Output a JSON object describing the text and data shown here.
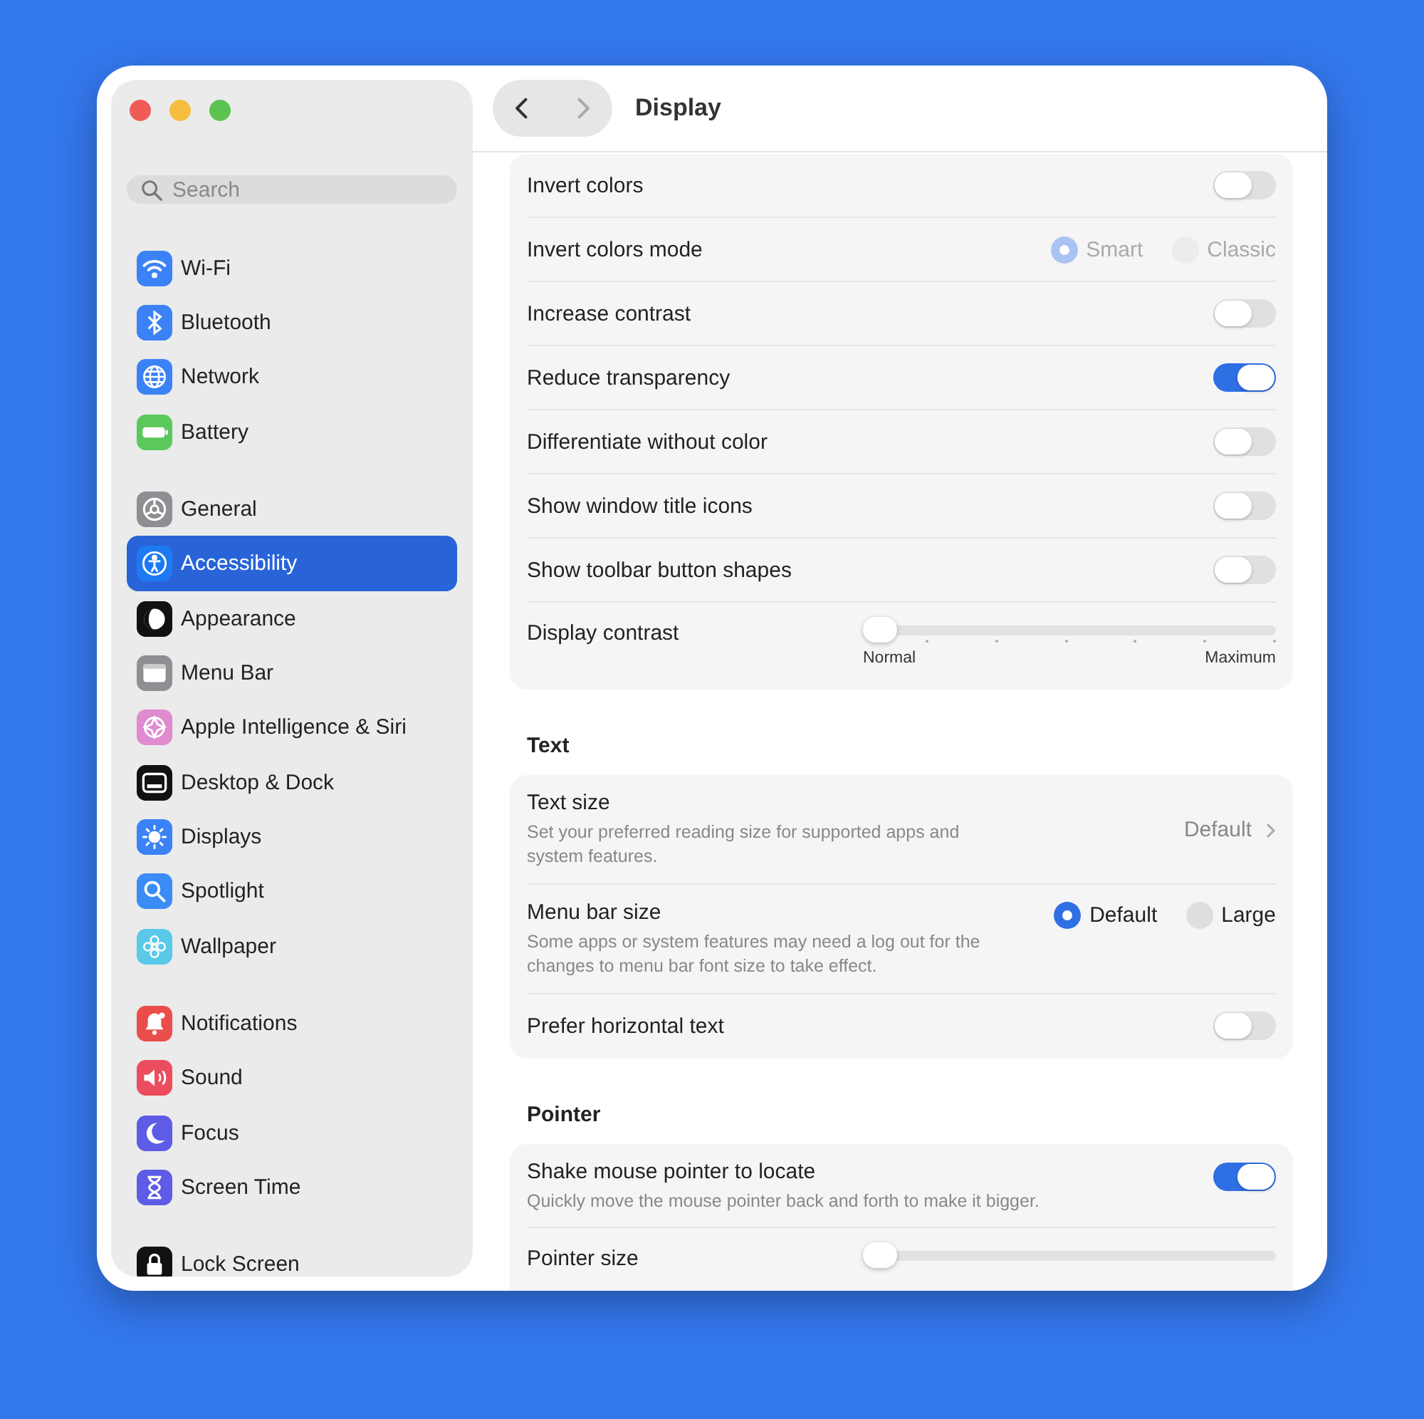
{
  "window": {
    "title": "Display"
  },
  "sidebar": {
    "search": {
      "placeholder": "Search"
    },
    "groups": [
      {
        "items": [
          {
            "label": "Wi-Fi",
            "color": "#3b82f6",
            "selected": false
          },
          {
            "label": "Bluetooth",
            "color": "#3b82f6",
            "selected": false
          },
          {
            "label": "Network",
            "color": "#3b82f6",
            "selected": false
          },
          {
            "label": "Battery",
            "color": "#5ac85a",
            "selected": false
          }
        ]
      },
      {
        "items": [
          {
            "label": "General",
            "color": "#8e8e93",
            "selected": false
          },
          {
            "label": "Accessibility",
            "color": "#1d7af2",
            "selected": true
          },
          {
            "label": "Appearance",
            "color": "#111111",
            "selected": false
          },
          {
            "label": "Menu Bar",
            "color": "#8e8e93",
            "selected": false
          },
          {
            "label": "Apple Intelligence & Siri",
            "color": "#e08ad0",
            "selected": false
          },
          {
            "label": "Desktop & Dock",
            "color": "#111111",
            "selected": false
          },
          {
            "label": "Displays",
            "color": "#3b82f6",
            "selected": false
          },
          {
            "label": "Spotlight",
            "color": "#3b8cf6",
            "selected": false
          },
          {
            "label": "Wallpaper",
            "color": "#5ac8e8",
            "selected": false
          }
        ]
      },
      {
        "items": [
          {
            "label": "Notifications",
            "color": "#eb4d4b",
            "selected": false
          },
          {
            "label": "Sound",
            "color": "#eb4d5e",
            "selected": false
          },
          {
            "label": "Focus",
            "color": "#5e5ce6",
            "selected": false
          },
          {
            "label": "Screen Time",
            "color": "#5e5ce6",
            "selected": false
          }
        ]
      },
      {
        "items": [
          {
            "label": "Lock Screen",
            "color": "#111111",
            "selected": false
          }
        ]
      }
    ]
  },
  "sections": [
    {
      "rows": [
        {
          "kind": "toggle",
          "label": "Invert colors",
          "on": false
        },
        {
          "kind": "radio",
          "label": "Invert colors mode",
          "disabled": true,
          "options": [
            {
              "label": "Smart",
              "selected": true
            },
            {
              "label": "Classic",
              "selected": false
            }
          ]
        },
        {
          "kind": "toggle",
          "label": "Increase contrast",
          "on": false
        },
        {
          "kind": "toggle",
          "label": "Reduce transparency",
          "on": true
        },
        {
          "kind": "toggle",
          "label": "Differentiate without color",
          "on": false
        },
        {
          "kind": "toggle",
          "label": "Show window title icons",
          "on": false
        },
        {
          "kind": "toggle",
          "label": "Show toolbar button shapes",
          "on": false
        },
        {
          "kind": "slider",
          "label": "Display contrast",
          "level": 0,
          "min_label": "Normal",
          "max_label": "Maximum"
        }
      ]
    },
    {
      "title": "Text",
      "rows": [
        {
          "kind": "value",
          "label": "Text size",
          "description": "Set your preferred reading size for supported apps and system features.",
          "value": "Default"
        },
        {
          "kind": "radio",
          "label": "Menu bar size",
          "description": "Some apps or system features may need a log out for the changes to menu bar font size to take effect.",
          "disabled": false,
          "options": [
            {
              "label": "Default",
              "selected": true
            },
            {
              "label": "Large",
              "selected": false
            }
          ]
        },
        {
          "kind": "toggle",
          "label": "Prefer horizontal text",
          "on": false
        }
      ]
    },
    {
      "title": "Pointer",
      "rows": [
        {
          "kind": "toggle",
          "label": "Shake mouse pointer to locate",
          "description": "Quickly move the mouse pointer back and forth to make it bigger.",
          "on": true
        },
        {
          "kind": "slider",
          "label": "Pointer size",
          "level": 0
        }
      ]
    }
  ]
}
